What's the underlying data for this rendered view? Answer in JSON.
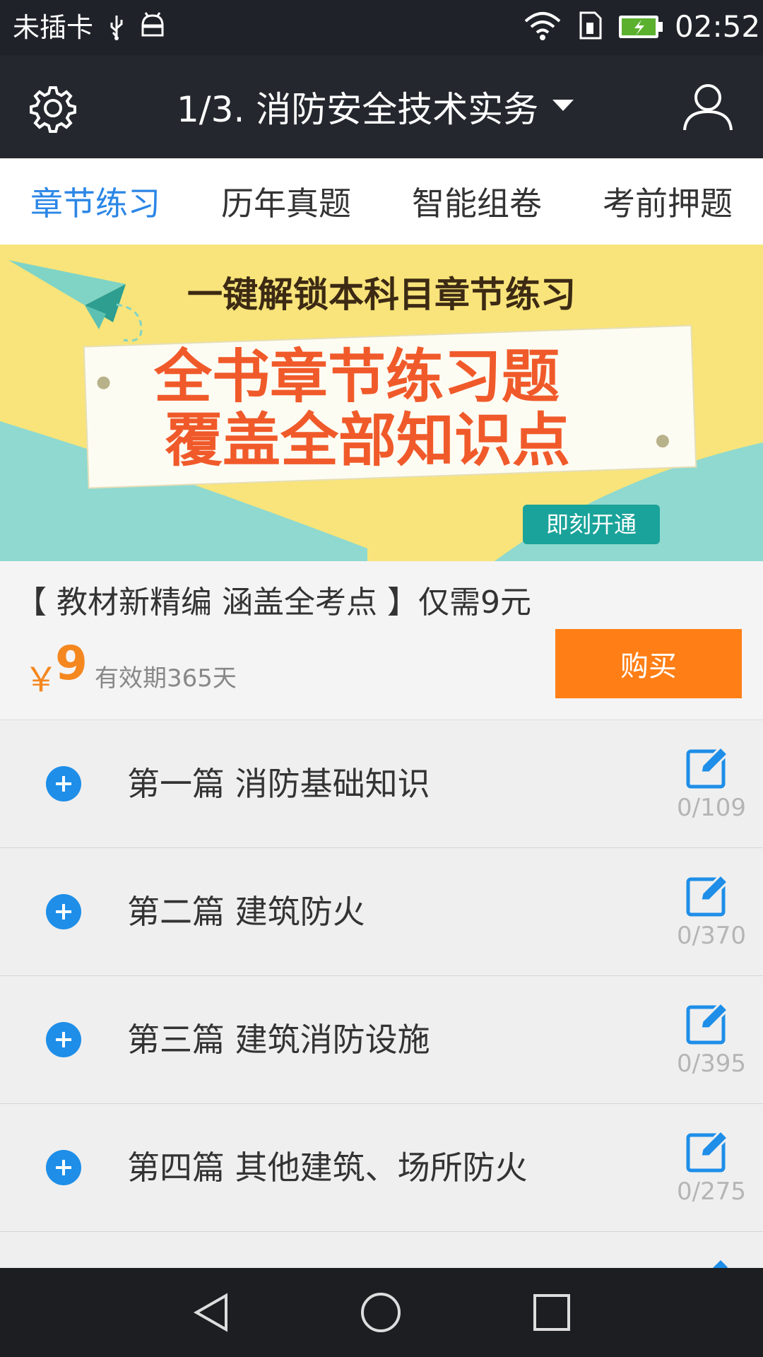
{
  "status_bar": {
    "carrier": "未插卡",
    "time": "02:52",
    "icons": [
      "usb-icon",
      "android-debug-icon",
      "wifi-icon",
      "sim-icon",
      "battery-charging-icon"
    ]
  },
  "app_bar": {
    "title": "1/3. 消防安全技术实务",
    "icons": [
      "settings-gear-icon",
      "caret-down-icon",
      "user-profile-icon"
    ]
  },
  "tabs": [
    {
      "label": "章节练习",
      "active": true
    },
    {
      "label": "历年真题",
      "active": false
    },
    {
      "label": "智能组卷",
      "active": false
    },
    {
      "label": "考前押题",
      "active": false
    }
  ],
  "banner": {
    "heading": "一键解锁本科目章节练习",
    "line1": "全书章节练习题",
    "line2": "覆盖全部知识点",
    "cta": "即刻开通",
    "colors": {
      "background": "#f8e47a",
      "teal": "#8fd9d0",
      "accent_red": "#f05a2a",
      "cta_bg": "#1aa39a"
    }
  },
  "promo": {
    "headline": "【 教材新精编 涵盖全考点 】仅需9元",
    "currency": "￥",
    "price": "9",
    "validity": "有效期365天",
    "buy_label": "购买",
    "colors": {
      "price": "#f5871f",
      "buy_button": "#ff7f16"
    }
  },
  "chapters": [
    {
      "title": "第一篇 消防基础知识",
      "progress": "0/109"
    },
    {
      "title": "第二篇 建筑防火",
      "progress": "0/370"
    },
    {
      "title": "第三篇 建筑消防设施",
      "progress": "0/395"
    },
    {
      "title": "第四篇 其他建筑、场所防火",
      "progress": "0/275"
    }
  ],
  "nav_bar": {
    "icons": [
      "back-triangle-icon",
      "home-circle-icon",
      "recents-square-icon"
    ]
  }
}
